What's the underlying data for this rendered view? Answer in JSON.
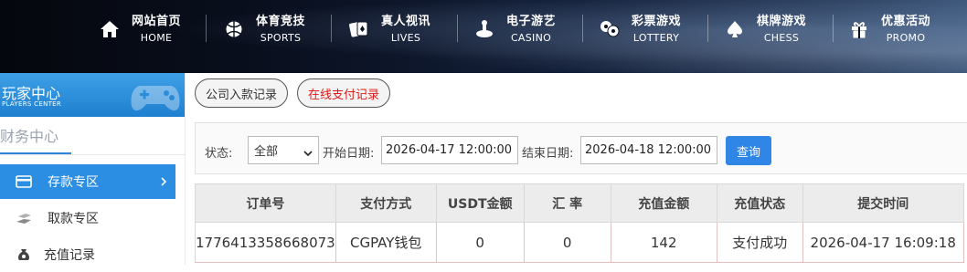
{
  "nav": {
    "items": [
      {
        "zh": "网站首页",
        "en": "HOME",
        "icon": "home-icon"
      },
      {
        "zh": "体育竞技",
        "en": "SPORTS",
        "icon": "basketball-icon"
      },
      {
        "zh": "真人视讯",
        "en": "LIVES",
        "icon": "cards-icon"
      },
      {
        "zh": "电子游艺",
        "en": "CASINO",
        "icon": "slot-icon"
      },
      {
        "zh": "彩票游戏",
        "en": "LOTTERY",
        "icon": "lottery-balls-icon"
      },
      {
        "zh": "棋牌游戏",
        "en": "CHESS",
        "icon": "spade-icon"
      },
      {
        "zh": "优惠活动",
        "en": "PROMO",
        "icon": "gift-icon"
      }
    ]
  },
  "sidebar": {
    "title": "玩家中心",
    "subtitle": "PLAYERS CENTER",
    "section": "财务中心",
    "items": [
      {
        "label": "存款专区",
        "icon": "card-icon",
        "active": true
      },
      {
        "label": "取款专区",
        "icon": "cash-icon",
        "active": false
      },
      {
        "label": "充值记录",
        "icon": "money-bag-icon",
        "active": false
      }
    ]
  },
  "tabs": [
    {
      "label": "公司入款记录",
      "active": false
    },
    {
      "label": "在线支付记录",
      "active": true
    }
  ],
  "filter": {
    "status_label": "状态:",
    "status_value": "全部",
    "start_label": "开始日期:",
    "start_value": "2026-04-17 12:00:00",
    "end_label": "结束日期:",
    "end_value": "2026-04-18 12:00:00",
    "query_label": "查询"
  },
  "table": {
    "headers": [
      "订单号",
      "支付方式",
      "USDT金额",
      "汇 率",
      "充值金额",
      "充值状态",
      "提交时间"
    ],
    "rows": [
      [
        "1776413358668073",
        "CGPAY钱包",
        "0",
        "0",
        "142",
        "支付成功",
        "2026-04-17 16:09:18"
      ]
    ]
  },
  "colors": {
    "accent": "#2b8ee3",
    "active_tab_text": "#e01818"
  }
}
